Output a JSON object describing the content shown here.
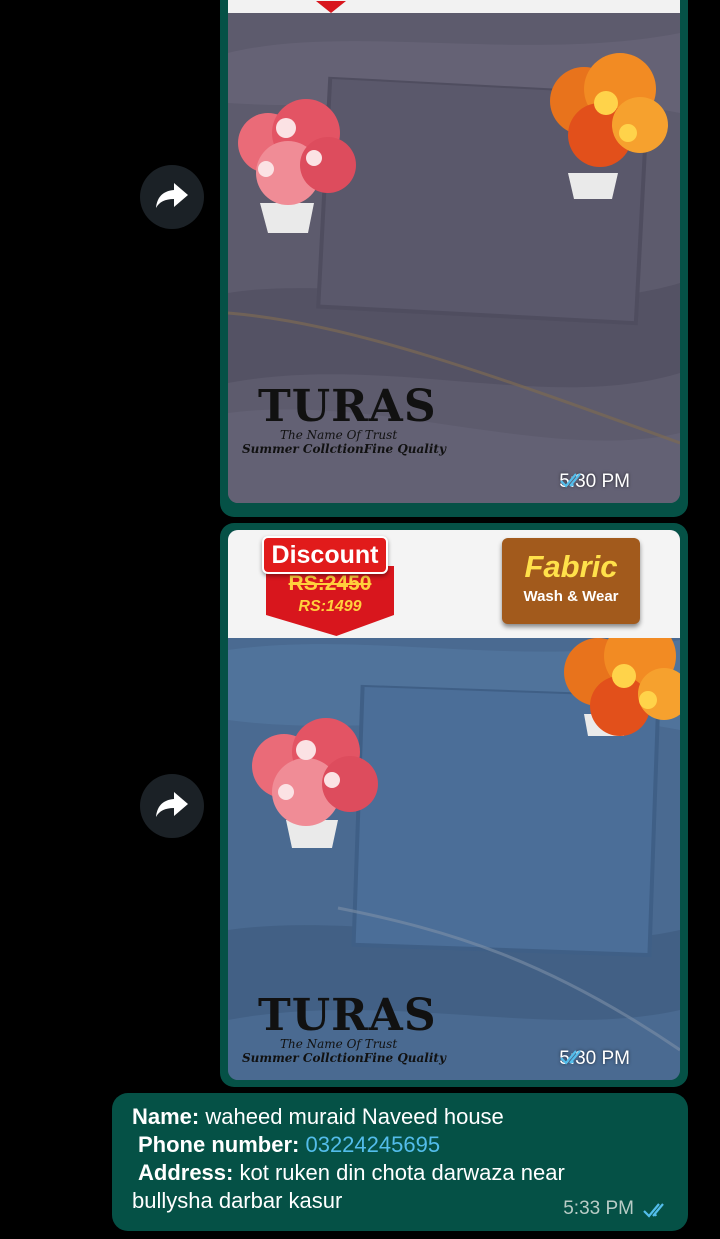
{
  "messages": [
    {
      "type": "image",
      "brand": "TURAS",
      "tagline": "The Name Of Trust",
      "collection": "Summer CollctionFine Quality",
      "time": "5:30 PM",
      "fabric_color": "#5b5a6b"
    },
    {
      "type": "image",
      "discount_label": "Discount",
      "old_price": "RS:2450",
      "new_price": "RS:1499",
      "fabric_title": "Fabric",
      "fabric_subtitle": "Wash & Wear",
      "brand": "TURAS",
      "tagline": "The Name Of Trust",
      "collection": "Summer CollctionFine Quality",
      "time": "5:30 PM",
      "fabric_color": "#4a6a91"
    },
    {
      "type": "text",
      "name_label": "Name:",
      "name_value": "waheed muraid Naveed house",
      "phone_label": "Phone number:",
      "phone_value": "03224245695",
      "address_label": "Address:",
      "address_value": "kot ruken din chota darwaza near",
      "address_value2": "bullysha darbar kasur",
      "time": "5:33 PM"
    }
  ],
  "icons": {
    "forward": "forward-icon",
    "read_receipt": "double-check-icon"
  },
  "colors": {
    "bubble": "#055146",
    "read_tick": "#53bdeb",
    "link": "#53bdeb"
  }
}
